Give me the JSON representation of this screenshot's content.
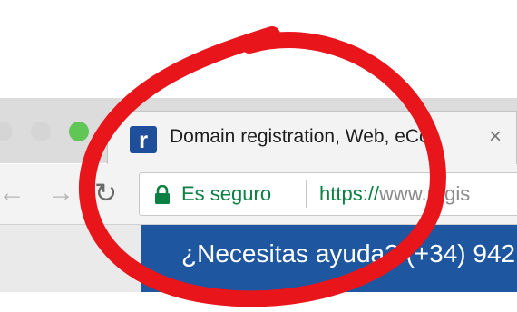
{
  "colors": {
    "secure_green": "#0b8043",
    "help_bar_blue": "#1e56a0",
    "annotation_red": "#e8151b",
    "favicon_blue": "#1f4e9b"
  },
  "window": {
    "controls": [
      "close-icon",
      "minimize-icon",
      "zoom-icon"
    ]
  },
  "tab": {
    "favicon_letter": "r",
    "title": "Domain registration, Web, eCo",
    "close_glyph": "×"
  },
  "toolbar": {
    "back_glyph": "←",
    "forward_glyph": "→",
    "reload_glyph": "↻"
  },
  "address_bar": {
    "security_label": "Es seguro",
    "url_scheme": "https://",
    "url_rest": "www.regis"
  },
  "help_banner": {
    "text": "¿Necesitas ayuda? (+34) 942"
  }
}
